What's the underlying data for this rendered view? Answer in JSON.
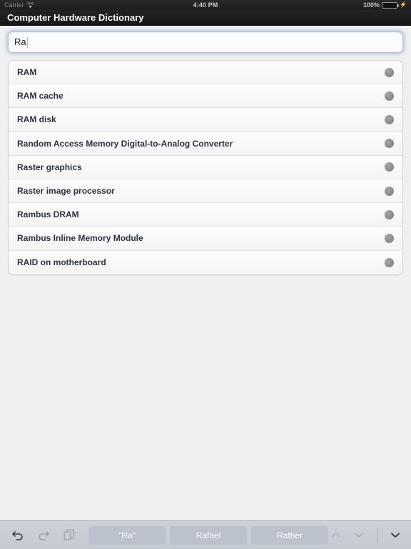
{
  "status_bar": {
    "carrier": "Carrier",
    "wifi_icon": "wifi-icon",
    "time": "4:40 PM",
    "battery_percent": "100%",
    "battery_level": 100,
    "charging_icon": "plug-icon",
    "battery_color": "#4cd964"
  },
  "title_bar": {
    "title": "Computer Hardware Dictionary"
  },
  "search": {
    "value": "Ra",
    "placeholder": "",
    "focused": true,
    "focus_glow_color": "#78a0dc"
  },
  "results": {
    "items": [
      {
        "label": "RAM"
      },
      {
        "label": "RAM cache"
      },
      {
        "label": "RAM disk"
      },
      {
        "label": "Random Access Memory Digital-to-Analog Converter"
      },
      {
        "label": "Raster graphics"
      },
      {
        "label": "Raster image processor"
      },
      {
        "label": "Rambus DRAM"
      },
      {
        "label": "Rambus Inline Memory Module"
      },
      {
        "label": "RAID on motherboard"
      }
    ],
    "accessory_icon": "circle-indicator",
    "accessory_color": "#8d8d8d"
  },
  "keyboard_toolbar": {
    "undo_icon": "undo-arrow-icon",
    "undo_enabled": true,
    "redo_icon": "redo-arrow-icon",
    "redo_enabled": false,
    "paste_icon": "copy-paste-icon",
    "paste_enabled": false,
    "suggestions": [
      {
        "label": "“Ra”"
      },
      {
        "label": "Rafael"
      },
      {
        "label": "Rather"
      }
    ],
    "prev_icon": "chevron-up-icon",
    "prev_enabled": false,
    "next_icon": "chevron-down-icon",
    "next_enabled": false,
    "dismiss_icon": "chevron-down-dismiss-icon",
    "dismiss_enabled": true,
    "background_color": "#ccd1d8",
    "suggestion_color": "#bcc2cb"
  }
}
